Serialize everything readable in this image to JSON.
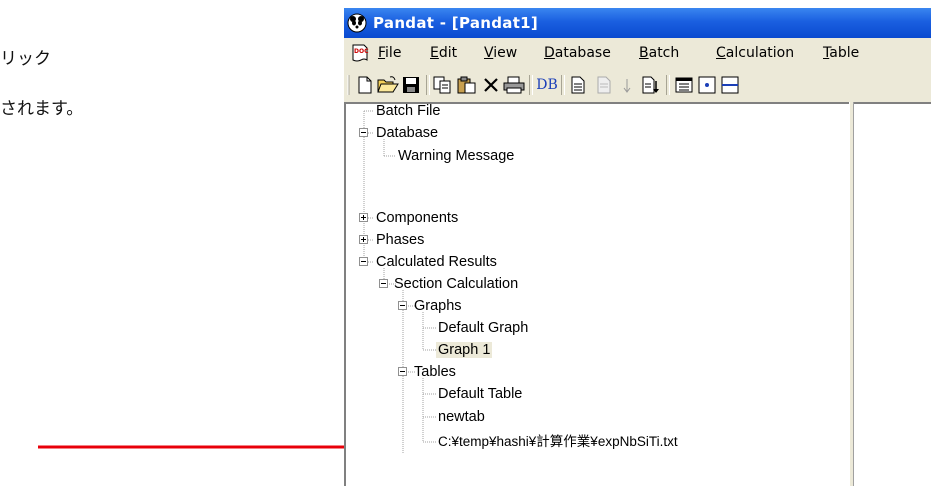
{
  "doc": {
    "line1": "リック",
    "line2": "されます。"
  },
  "window": {
    "title": "Pandat - [Pandat1]"
  },
  "menu": {
    "items": [
      {
        "label": "File",
        "accel": "F"
      },
      {
        "label": "Edit",
        "accel": "E"
      },
      {
        "label": "View",
        "accel": "V"
      },
      {
        "label": "Database",
        "accel": "D"
      },
      {
        "label": "Batch",
        "accel": "B"
      },
      {
        "label": "Calculation",
        "accel": "C"
      },
      {
        "label": "Table",
        "accel": "T"
      }
    ]
  },
  "toolbar": {
    "db_label": "DB",
    "icons": [
      "new-icon",
      "open-icon",
      "save-icon",
      "copy-icon",
      "paste-icon",
      "delete-icon",
      "print-icon",
      "db-icon",
      "page-icon",
      "page-disabled-icon",
      "down-arrow-icon",
      "sort-icon",
      "table-icon",
      "dot-box-icon",
      "minus-box-icon"
    ]
  },
  "tree": {
    "nodes": [
      {
        "label": "Batch File",
        "level": 0,
        "expander": "none"
      },
      {
        "label": "Database",
        "level": 0,
        "expander": "minus"
      },
      {
        "label": "Warning Message",
        "level": 1,
        "expander": "none"
      },
      {
        "label": "Components",
        "level": 0,
        "expander": "plus"
      },
      {
        "label": "Phases",
        "level": 0,
        "expander": "plus"
      },
      {
        "label": "Calculated Results",
        "level": 0,
        "expander": "minus"
      },
      {
        "label": "Section Calculation",
        "level": 1,
        "expander": "minus"
      },
      {
        "label": "Graphs",
        "level": 2,
        "expander": "minus"
      },
      {
        "label": "Default Graph",
        "level": 3,
        "expander": "none"
      },
      {
        "label": "Graph 1",
        "level": 3,
        "expander": "none",
        "selected": true
      },
      {
        "label": "Tables",
        "level": 2,
        "expander": "minus"
      },
      {
        "label": "Default Table",
        "level": 3,
        "expander": "none"
      },
      {
        "label": "newtab",
        "level": 3,
        "expander": "none"
      },
      {
        "label": "C:¥temp¥hashi¥計算作業¥expNbSiTi.txt",
        "level": 3,
        "expander": "none"
      }
    ]
  },
  "colors": {
    "arrow": "#e8000a",
    "titlebar": "#0a4ad0",
    "chrome": "#ece9d8"
  }
}
